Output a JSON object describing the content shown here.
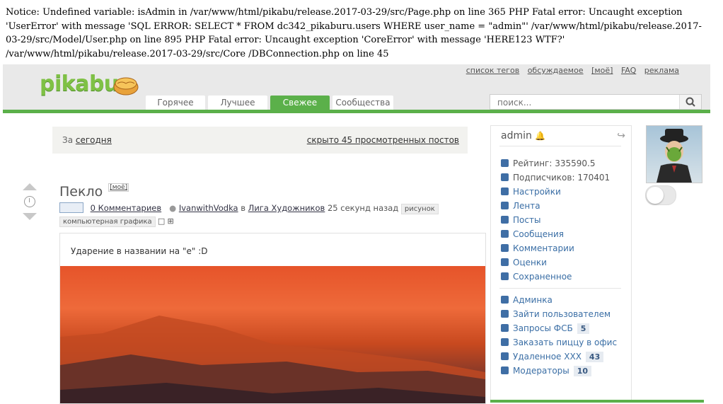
{
  "notice": {
    "text": "Notice: Undefined variable: isAdmin in /var/www/html/pikabu/release.2017-03-29/src/Page.php on line 365 PHP Fatal error: Uncaught exception 'UserError' with message 'SQL ERROR: SELECT * FROM dc342_pikaburu.users WHERE user_name = \"admin\"' /var/www/html/pikabu/release.2017-03-29/src/Model/User.php on line 895 PHP Fatal error: Uncaught exception 'CoreError' with message 'HERE123 WTF?' /var/www/html/pikabu/release.2017-03-29/src/Core /DBConnection.php on line 45"
  },
  "header": {
    "logo": "pikabu",
    "top_links": [
      "список тегов",
      "обсуждаемое",
      "[моё]",
      "FAQ",
      "реклама"
    ],
    "tabs": [
      "Горячее",
      "Лучшее",
      "Свежее",
      "Сообщества"
    ],
    "active_tab": "Свежее",
    "search_placeholder": "поиск..."
  },
  "filter": {
    "prefix": "За",
    "period": "сегодня",
    "hidden": "скрыто 45 просмотренных постов"
  },
  "post": {
    "title": "Пекло",
    "mine": "[моё]",
    "comments": "0 Комментариев",
    "author": "IvanwithVodka",
    "in": "в",
    "community": "Лига Художников",
    "time": "25 секунд назад",
    "tag1": "рисунок",
    "tag2": "компьютерная графика",
    "text": "Ударение в названии на \"е\" :D"
  },
  "user": {
    "name": "admin",
    "stats": [
      {
        "label": "Рейтинг: 335590.5"
      },
      {
        "label": "Подписчиков: 170401"
      }
    ],
    "menu": [
      {
        "label": "Настройки",
        "icon": "gear-icon"
      },
      {
        "label": "Лента",
        "icon": "feed-icon"
      },
      {
        "label": "Посты",
        "icon": "posts-icon"
      },
      {
        "label": "Сообщения",
        "icon": "mail-icon"
      },
      {
        "label": "Комментарии",
        "icon": "comments-icon"
      },
      {
        "label": "Оценки",
        "icon": "rating-icon"
      },
      {
        "label": "Сохраненное",
        "icon": "saved-icon"
      }
    ],
    "admin": [
      {
        "label": "Админка",
        "icon": "shield-icon",
        "badge": ""
      },
      {
        "label": "Зайти пользователем",
        "icon": "user-icon",
        "badge": ""
      },
      {
        "label": "Запросы ФСБ",
        "icon": "shield-question-icon",
        "badge": "5"
      },
      {
        "label": "Заказать пиццу в офис",
        "icon": "pizza-icon",
        "badge": ""
      },
      {
        "label": "Удаленное XXX",
        "icon": "smile-icon",
        "badge": "43"
      },
      {
        "label": "Модераторы",
        "icon": "shield-icon",
        "badge": "10"
      }
    ]
  },
  "colors": {
    "accent": "#5bb04a",
    "link": "#3a6ea5"
  }
}
